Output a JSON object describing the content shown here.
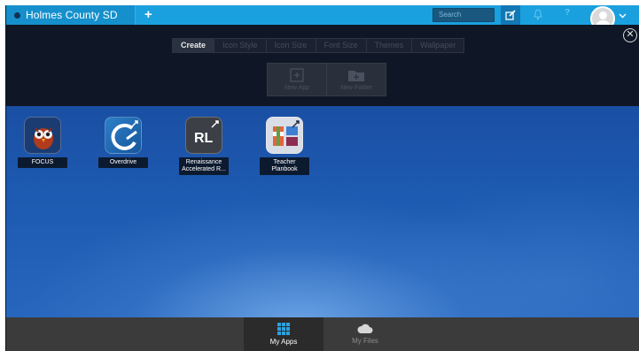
{
  "topbar": {
    "tab_title": "Holmes County SD",
    "add_tab_symbol": "+",
    "search_placeholder": "Search",
    "help_symbol": "?"
  },
  "panel": {
    "close_symbol": "✕",
    "tabs": [
      {
        "label": "Create",
        "active": true
      },
      {
        "label": "Icon Style",
        "active": false
      },
      {
        "label": "Icon Size",
        "active": false
      },
      {
        "label": "Font Size",
        "active": false
      },
      {
        "label": "Themes",
        "active": false
      },
      {
        "label": "Wallpaper",
        "active": false
      }
    ],
    "actions": [
      {
        "label": "New App",
        "icon": "plus-square-icon"
      },
      {
        "label": "New Folder",
        "icon": "folder-plus-icon"
      }
    ]
  },
  "apps": [
    {
      "label": "FOCUS",
      "icon": "focus-owl-icon"
    },
    {
      "label": "Overdrive",
      "icon": "overdrive-icon"
    },
    {
      "label": "Renaissance Accelerated R...",
      "icon": "renaissance-rl-icon",
      "icon_text": "RL"
    },
    {
      "label": "Teacher Planbook",
      "icon": "teacher-planbook-icon"
    }
  ],
  "bottombar": {
    "tabs": [
      {
        "label": "My Apps",
        "icon": "grid-icon",
        "active": true
      },
      {
        "label": "My Files",
        "icon": "cloud-icon",
        "active": false
      }
    ]
  },
  "colors": {
    "topbar": "#1aa0de",
    "panel": "#0f1726",
    "desktop": "#1d5bb2",
    "bottombar": "#3b3b3b",
    "active_tab_icon": "#2aa3e0"
  }
}
